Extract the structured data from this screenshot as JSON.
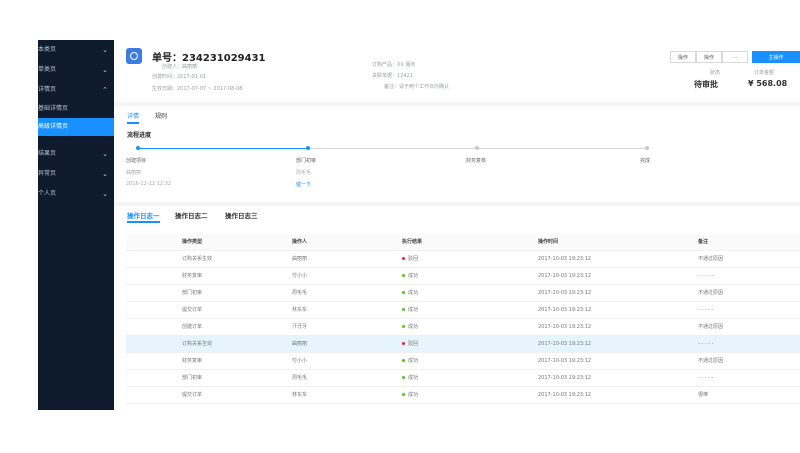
{
  "sidebar": {
    "items": [
      {
        "label": "本类页",
        "chev": "⌄"
      },
      {
        "label": "单类页",
        "chev": "⌄"
      },
      {
        "label": "详情页",
        "chev": "⌃"
      }
    ],
    "subitems": [
      {
        "label": "基础详情页",
        "active": false
      },
      {
        "label": "高级详情页",
        "active": true
      }
    ],
    "items2": [
      {
        "label": "结果页",
        "chev": "⌄"
      },
      {
        "label": "异常页",
        "chev": "⌄"
      },
      {
        "label": "个人页",
        "chev": "⌄"
      }
    ]
  },
  "header": {
    "title": "单号：234231029431",
    "creator": "创建人：曲丽丽",
    "create_time": "创建时间：2017-01-01",
    "effective_date": "生效日期：2017-07-07 ~ 2017-08-08",
    "product": "订购产品：XX 服务",
    "related_doc": "关联单据：12421",
    "remark": "备注：请于两个工作日内确认",
    "buttons": [
      "操作",
      "操作",
      "···",
      "主操作"
    ],
    "status_label": "状态",
    "status_value": "待审批",
    "amount_label": "订单金额",
    "amount_value": "¥ 568.08"
  },
  "detail_tabs": [
    "详情",
    "规则"
  ],
  "progress": {
    "title": "流程进度",
    "steps": [
      {
        "label": "创建项目",
        "meta1": "曲丽丽",
        "meta2": "2016-12-12 12:32",
        "done": true
      },
      {
        "label": "部门初审",
        "meta1": "周毛毛",
        "meta2": "催一下",
        "done": true
      },
      {
        "label": "财务复核",
        "done": false
      },
      {
        "label": "完成",
        "done": false
      }
    ]
  },
  "log_tabs": [
    "操作日志一",
    "操作日志二",
    "操作日志三"
  ],
  "table": {
    "headers": [
      "操作类型",
      "操作人",
      "执行结果",
      "操作时间",
      "备注"
    ],
    "rows": [
      {
        "type": "订购关系生效",
        "user": "曲丽丽",
        "result": "驳回",
        "status": "error",
        "time": "2017-10-03 19:23:12",
        "note": "不通过原因"
      },
      {
        "type": "财务复审",
        "user": "付小小",
        "result": "成功",
        "status": "success",
        "time": "2017-10-03 19:23:12",
        "note": "- - - - -"
      },
      {
        "type": "部门初审",
        "user": "周毛毛",
        "result": "成功",
        "status": "success",
        "time": "2017-10-03 19:23:12",
        "note": "不通过原因"
      },
      {
        "type": "提交订单",
        "user": "林东东",
        "result": "成功",
        "status": "success",
        "time": "2017-10-03 19:23:12",
        "note": "- - - - -"
      },
      {
        "type": "创建订单",
        "user": "汗牙牙",
        "result": "成功",
        "status": "success",
        "time": "2017-10-03 19:23:12",
        "note": "不通过原因"
      },
      {
        "type": "订购关系生效",
        "user": "曲丽丽",
        "result": "驳回",
        "status": "error",
        "time": "2017-10-03 19:23:12",
        "note": "- - - - -"
      },
      {
        "type": "财务复审",
        "user": "付小小",
        "result": "成功",
        "status": "success",
        "time": "2017-10-03 19:23:12",
        "note": "不通过原因"
      },
      {
        "type": "部门初审",
        "user": "周毛毛",
        "result": "成功",
        "status": "success",
        "time": "2017-10-03 19:23:12",
        "note": "- - - - -"
      },
      {
        "type": "提交订单",
        "user": "林东东",
        "result": "成功",
        "status": "success",
        "time": "2017-10-03 19:23:12",
        "note": "很棒"
      }
    ]
  },
  "colors": {
    "accent": "#1890ff",
    "success": "#52c41a",
    "error": "#f5222d",
    "sidebar": "#0e1a2d"
  }
}
